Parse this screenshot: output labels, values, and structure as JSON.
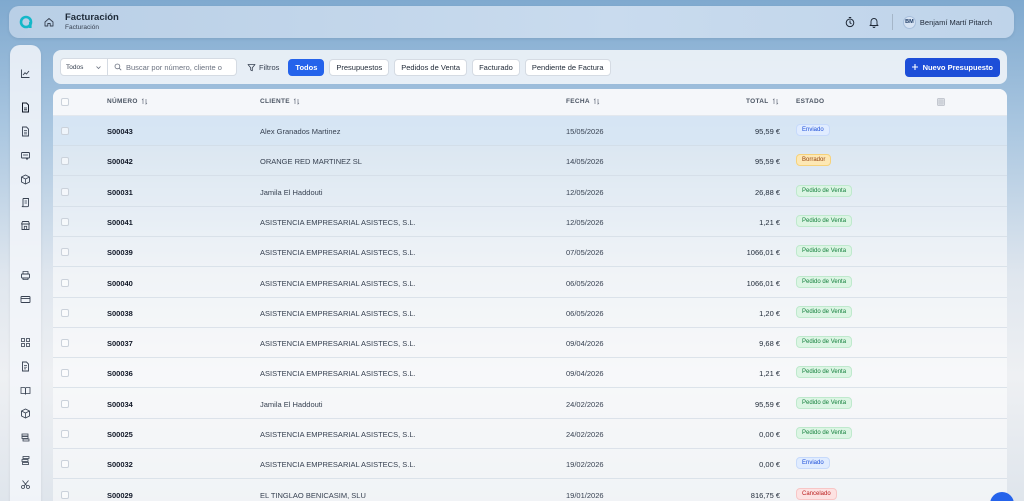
{
  "header": {
    "title": "Facturación",
    "subtitle": "Facturación",
    "user_initials": "BM",
    "user_name": "Benjamí Martí Pitarch"
  },
  "toolbar": {
    "select_value": "Todos",
    "search_placeholder": "Buscar por número, cliente o",
    "filters_label": "Filtros",
    "tabs": [
      {
        "label": "Todos",
        "active": true
      },
      {
        "label": "Presupuestos",
        "active": false
      },
      {
        "label": "Pedidos de Venta",
        "active": false
      },
      {
        "label": "Facturado",
        "active": false
      },
      {
        "label": "Pendiente de Factura",
        "active": false
      }
    ],
    "new_button_label": "Nuevo Presupuesto"
  },
  "table": {
    "columns": {
      "number": "NÚMERO",
      "client": "CLIENTE",
      "date": "FECHA",
      "total": "TOTAL",
      "status": "ESTADO"
    },
    "rows": [
      {
        "number": "S00043",
        "client": "Alex Granados Martinez",
        "date": "15/05/2026",
        "total": "95,59 €",
        "status": "Enviado",
        "status_kind": "enviado"
      },
      {
        "number": "S00042",
        "client": "ORANGE RED MARTINEZ SL",
        "date": "14/05/2026",
        "total": "95,59 €",
        "status": "Borrador",
        "status_kind": "borrador"
      },
      {
        "number": "S00031",
        "client": "Jamila El Haddouti",
        "date": "12/05/2026",
        "total": "26,88 €",
        "status": "Pedido de Venta",
        "status_kind": "pedido"
      },
      {
        "number": "S00041",
        "client": "ASISTENCIA EMPRESARIAL ASISTECS, S.L.",
        "date": "12/05/2026",
        "total": "1,21 €",
        "status": "Pedido de Venta",
        "status_kind": "pedido"
      },
      {
        "number": "S00039",
        "client": "ASISTENCIA EMPRESARIAL ASISTECS, S.L.",
        "date": "07/05/2026",
        "total": "1066,01 €",
        "status": "Pedido de Venta",
        "status_kind": "pedido"
      },
      {
        "number": "S00040",
        "client": "ASISTENCIA EMPRESARIAL ASISTECS, S.L.",
        "date": "06/05/2026",
        "total": "1066,01 €",
        "status": "Pedido de Venta",
        "status_kind": "pedido"
      },
      {
        "number": "S00038",
        "client": "ASISTENCIA EMPRESARIAL ASISTECS, S.L.",
        "date": "06/05/2026",
        "total": "1,20 €",
        "status": "Pedido de Venta",
        "status_kind": "pedido"
      },
      {
        "number": "S00037",
        "client": "ASISTENCIA EMPRESARIAL ASISTECS, S.L.",
        "date": "09/04/2026",
        "total": "9,68 €",
        "status": "Pedido de Venta",
        "status_kind": "pedido"
      },
      {
        "number": "S00036",
        "client": "ASISTENCIA EMPRESARIAL ASISTECS, S.L.",
        "date": "09/04/2026",
        "total": "1,21 €",
        "status": "Pedido de Venta",
        "status_kind": "pedido"
      },
      {
        "number": "S00034",
        "client": "Jamila El Haddouti",
        "date": "24/02/2026",
        "total": "95,59 €",
        "status": "Pedido de Venta",
        "status_kind": "pedido"
      },
      {
        "number": "S00025",
        "client": "ASISTENCIA EMPRESARIAL ASISTECS, S.L.",
        "date": "24/02/2026",
        "total": "0,00 €",
        "status": "Pedido de Venta",
        "status_kind": "pedido"
      },
      {
        "number": "S00032",
        "client": "ASISTENCIA EMPRESARIAL ASISTECS, S.L.",
        "date": "19/02/2026",
        "total": "0,00 €",
        "status": "Enviado",
        "status_kind": "enviado"
      },
      {
        "number": "S00029",
        "client": "EL TINGLAO BENICASIM, SLU",
        "date": "19/01/2026",
        "total": "816,75 €",
        "status": "Cancelado",
        "status_kind": "cancelado"
      }
    ]
  },
  "colors": {
    "accent": "#2563eb",
    "primary_button": "#1d4ed8"
  },
  "icons": {
    "logo": "app-logo-icon",
    "home": "home-icon",
    "timer": "timer-icon",
    "bell": "bell-icon",
    "search": "search-icon",
    "filter": "filter-icon",
    "plus": "plus-icon",
    "sort": "sort-icon",
    "columns": "columns-icon"
  }
}
